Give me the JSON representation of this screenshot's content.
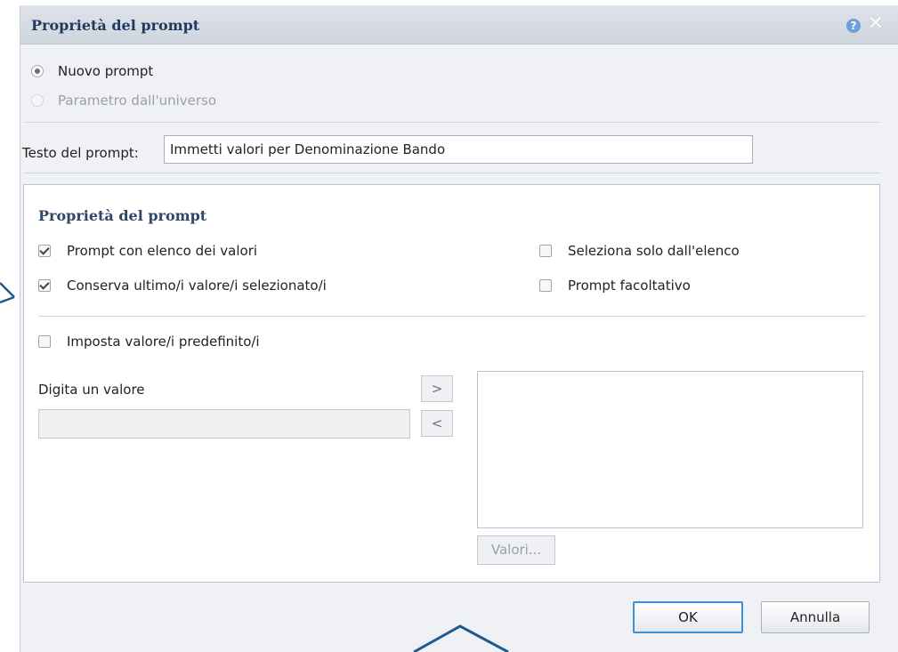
{
  "dialog": {
    "title": "Proprietà del prompt",
    "help_icon": "question-icon",
    "close_icon": "close-icon"
  },
  "source_options": [
    {
      "label": "Nuovo prompt",
      "selected": true,
      "enabled": true
    },
    {
      "label": "Parametro dall'universo",
      "selected": false,
      "enabled": false
    }
  ],
  "prompt_text": {
    "label": "Testo del prompt:",
    "value": "Immetti valori per Denominazione Bando"
  },
  "properties": {
    "section_title": "Proprietà del prompt",
    "options": [
      {
        "label": "Prompt con elenco dei valori",
        "checked": true
      },
      {
        "label": "Conserva ultimo/i valore/i selezionato/i",
        "checked": true
      },
      {
        "label": "Seleziona solo dall'elenco",
        "checked": false
      },
      {
        "label": "Prompt facoltativo",
        "checked": false
      }
    ],
    "default_values": {
      "label": "Imposta valore/i predefinito/i",
      "checked": false
    }
  },
  "value_entry": {
    "label": "Digita un valore",
    "value": "",
    "add_label": ">",
    "remove_label": "<",
    "values_button": "Valori..."
  },
  "footer": {
    "ok_label": "OK",
    "cancel_label": "Annulla"
  },
  "colors": {
    "title_text": "#1f3a5f",
    "panel_border": "#b7c3d6",
    "primary_border": "#3e8fd6",
    "annotation": "#1f5a8f"
  }
}
